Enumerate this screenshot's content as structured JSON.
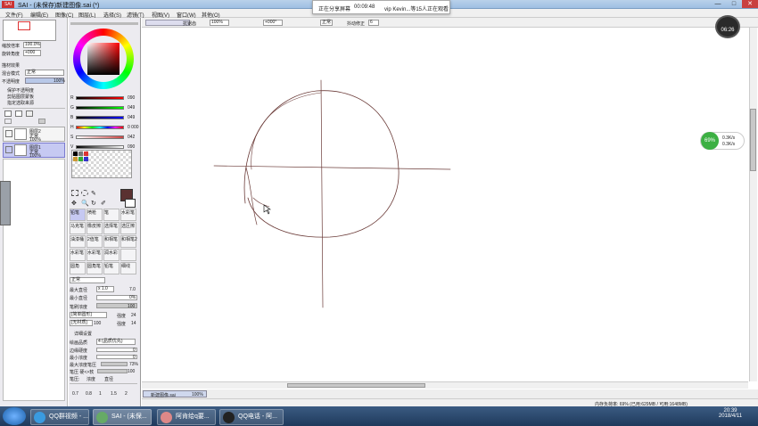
{
  "window": {
    "app_logo": "SAI",
    "title": "SAI - (未保存)新建图像.sai (*)",
    "minimize": "—",
    "maximize": "□",
    "close": "✕"
  },
  "menu": [
    "文件(F)",
    "编辑(E)",
    "图像(C)",
    "图层(L)",
    "选择(S)",
    "滤镜(T)",
    "视图(V)",
    "窗口(W)",
    "其他(O)"
  ],
  "share_overlay": {
    "status": "正在分享屏幕",
    "time": "00:09:48",
    "viewers": "vip Kevin...等15人正在观看"
  },
  "navigator": {
    "zoom_label": "缩放倍率",
    "zoom_value": "100.0%",
    "angle_label": "旋转角度",
    "angle_value": "+000"
  },
  "layer_props": {
    "effect_label": "描材效果",
    "blend_label": "混合模式",
    "blend_value": "正常",
    "opacity_label": "不透明度",
    "opacity_value": "100%",
    "options": [
      "保护不透明度",
      "剪贴图层蒙板",
      "指定选取来源"
    ]
  },
  "layers": [
    {
      "name": "图层2",
      "mode": "正常",
      "opacity": "100%",
      "selected": false
    },
    {
      "name": "图层1",
      "mode": "正常",
      "opacity": "100%",
      "selected": true
    }
  ],
  "color_sliders": [
    {
      "label": "R",
      "value": "090"
    },
    {
      "label": "G",
      "value": "049"
    },
    {
      "label": "B",
      "value": "049"
    },
    {
      "label": "H",
      "value": "0 000"
    },
    {
      "label": "S",
      "value": "042"
    },
    {
      "label": "V",
      "value": "090"
    }
  ],
  "tools": [
    [
      "铅笔",
      "喷枪",
      "笔",
      "水彩笔"
    ],
    [
      "马克笔",
      "橡皮擦",
      "选择笔",
      "选区擦"
    ],
    [
      "油漆桶",
      "2值笔",
      "和相笔",
      "和相笔2"
    ],
    [
      "水彩笔",
      "水彩笔",
      "润水彩",
      ""
    ],
    [
      "圆角",
      "圆角笔",
      "铅笔",
      "细线"
    ]
  ],
  "brush": {
    "mode": "正常",
    "max_size_label": "最大直径",
    "max_size_value": "x 1.0",
    "max_size_num": "7.0",
    "min_size_label": "最小直径",
    "min_size_value": "0%",
    "density_label": "笔刷浓度",
    "density_value": "100",
    "shape_label": "[简单圆形]",
    "shape_value": "强度",
    "shape_num": "24",
    "texture_label": "[无材质]",
    "texture_num": "100",
    "texture_value": "强度",
    "texture_num2": "14",
    "detail_label": "详细设置",
    "quality_label": "绘画品质",
    "quality_value": "4 (品质优先)",
    "edge_label": "边缘硬度",
    "edge_value": "0",
    "min_density_label": "最小浓度",
    "min_density_value": "0",
    "max_pressure_label": "最大浓度笔压",
    "max_pressure_value": "73%",
    "pressure_label": "笔压 硬<>软",
    "pressure_value": "100",
    "pressure_toggle": "笔压:",
    "pressure_opts": [
      "浓度",
      "直径"
    ],
    "presets": [
      "0.7",
      "0.8",
      "1",
      "1.5",
      "2"
    ]
  },
  "canvas_toolbar": {
    "anti_alias": "抗锯齿",
    "zoom": "100%",
    "angle": "+000°",
    "mode": "正常",
    "stabilizer_label": "抖动修正",
    "stabilizer_value": "6"
  },
  "doc_tab": {
    "name": "新建图像.sai",
    "zoom": "100%"
  },
  "status": {
    "memory": "内存负荷率: 69%  (已用:629MB / 可用:1648MB)"
  },
  "overlays": {
    "timer": "06:26",
    "net_percent": "69%",
    "net_up": "0.3K/s",
    "net_down": "0.3K/s"
  },
  "taskbar": {
    "tasks": [
      "QQ群视频 - ...",
      "SAI - (未保...",
      "阿肯给q要...",
      "QQ电话 - 阿..."
    ],
    "time": "20:39",
    "date": "2018/4/11"
  },
  "colors": {
    "current_color": "#5a3131",
    "stroke": "#6b3b38",
    "accent": "#3cb043"
  }
}
